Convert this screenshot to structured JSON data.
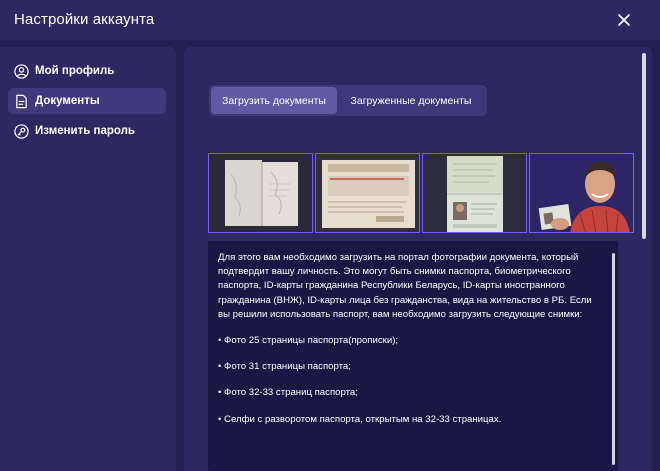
{
  "header": {
    "title": "Настройки аккаунта"
  },
  "sidebar": {
    "items": [
      {
        "label": "Мой профиль",
        "icon": "user-icon"
      },
      {
        "label": "Документы",
        "icon": "document-icon"
      },
      {
        "label": "Изменить пароль",
        "icon": "key-icon"
      }
    ]
  },
  "tabs": [
    {
      "label": "Загрузить документы"
    },
    {
      "label": "Загруженные документы"
    }
  ],
  "content": {
    "intro": "Для этого вам необходимо загрузить на портал фотографии документа, который подтвердит вашу личность. Это могут быть снимки паспорта, биометрического паспорта, ID-карты гражданина Республики Беларусь, ID-карты иностранного гражданина (ВНЖ), ID-карты лица без гражданства, вида на жительство в РБ. Если вы решили использовать паспорт, вам необходимо загрузить следующие снимки:",
    "bullets": [
      "• Фото 25 страницы паспорта(прописки);",
      "• Фото 31 страницы паспорта;",
      "• Фото 32-33 страниц паспорта;",
      "• Селфи с разворотом паспорта, открытым на 32-33 страницах."
    ]
  },
  "colors": {
    "background": "#221f52",
    "panel": "#2b2862",
    "active_item": "#3e3a7c",
    "active_tab": "#5e5ba3",
    "textbox": "#1a1744",
    "thumb_border": "#7c5cff"
  }
}
